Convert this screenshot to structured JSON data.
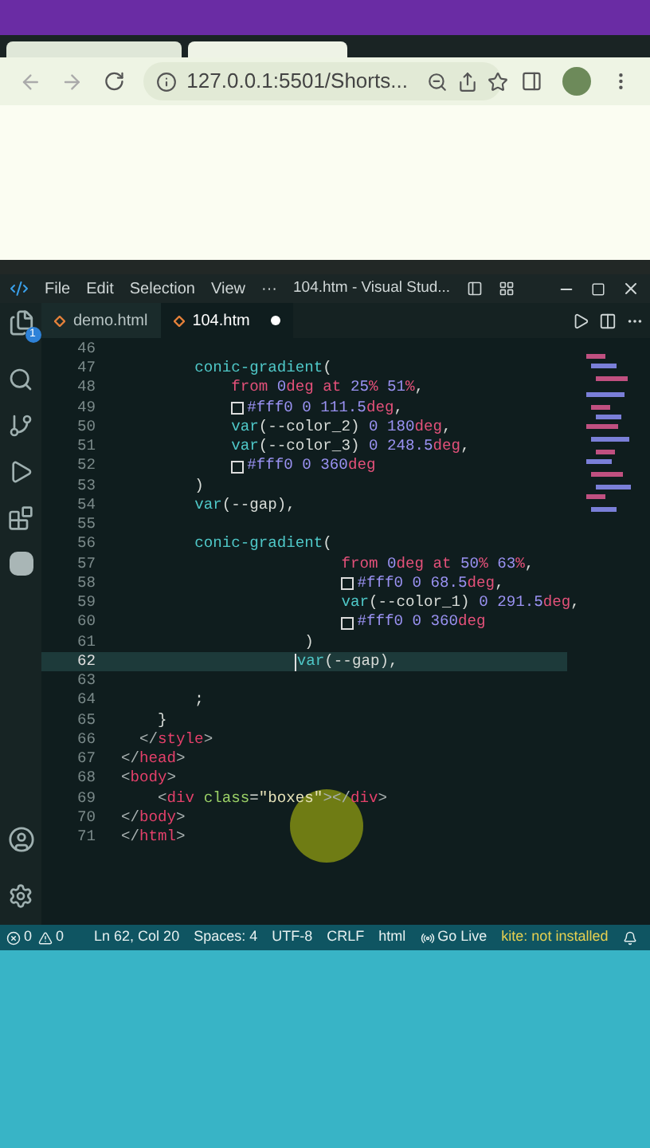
{
  "browser": {
    "address": "127.0.0.1:5501/Shorts..."
  },
  "editor": {
    "title": "104.htm - Visual Stud...",
    "menu": [
      "File",
      "Edit",
      "Selection",
      "View",
      "···"
    ],
    "explorer_badge": "1",
    "tabs": [
      {
        "label": "demo.html",
        "selected": false,
        "modified": false
      },
      {
        "label": "104.htm",
        "selected": true,
        "modified": true
      }
    ],
    "lines": [
      {
        "number": "46",
        "current": false
      },
      {
        "number": "47",
        "current": false,
        "kind": "value",
        "tokens": [
          {
            "kind": "fn",
            "text": "conic-gradient"
          },
          {
            "kind": "plain",
            "text": "("
          }
        ]
      },
      {
        "number": "48",
        "current": false,
        "kind": "argument",
        "tokens": [
          {
            "kind": "kw",
            "text": "from"
          },
          {
            "kind": "num",
            "text": " 0"
          },
          {
            "kind": "unit",
            "text": "deg"
          },
          {
            "kind": "kw",
            "text": " at"
          },
          {
            "kind": "num",
            "text": " 25"
          },
          {
            "kind": "unit",
            "text": "%"
          },
          {
            "kind": "num",
            "text": " 51"
          },
          {
            "kind": "unit",
            "text": "%"
          },
          {
            "kind": "plain",
            "text": ","
          }
        ]
      },
      {
        "number": "49",
        "current": false,
        "kind": "argument",
        "tokens": [
          {
            "kind": "swatch"
          },
          {
            "kind": "num",
            "text": "#fff0 0 111.5"
          },
          {
            "kind": "unit",
            "text": "deg"
          },
          {
            "kind": "plain",
            "text": ","
          }
        ]
      },
      {
        "number": "50",
        "current": false,
        "kind": "argument",
        "tokens": [
          {
            "kind": "fn",
            "text": "var"
          },
          {
            "kind": "plain",
            "text": "(--color_2) "
          },
          {
            "kind": "num",
            "text": "0 180"
          },
          {
            "kind": "unit",
            "text": "deg"
          },
          {
            "kind": "plain",
            "text": ","
          }
        ]
      },
      {
        "number": "51",
        "current": false,
        "kind": "argument",
        "tokens": [
          {
            "kind": "fn",
            "text": "var"
          },
          {
            "kind": "plain",
            "text": "(--color_3) "
          },
          {
            "kind": "num",
            "text": "0 248.5"
          },
          {
            "kind": "unit",
            "text": "deg"
          },
          {
            "kind": "plain",
            "text": ","
          }
        ]
      },
      {
        "number": "52",
        "current": false,
        "kind": "argument",
        "tokens": [
          {
            "kind": "swatch"
          },
          {
            "kind": "num",
            "text": "#fff0 0 360"
          },
          {
            "kind": "unit",
            "text": "deg"
          }
        ]
      },
      {
        "number": "53",
        "current": false,
        "kind": "value",
        "tokens": [
          {
            "kind": "plain",
            "text": ")"
          }
        ]
      },
      {
        "number": "54",
        "current": false,
        "kind": "value",
        "tokens": [
          {
            "kind": "fn",
            "text": "var"
          },
          {
            "kind": "plain",
            "text": "(--gap),"
          }
        ]
      },
      {
        "number": "55",
        "current": false
      },
      {
        "number": "56",
        "current": false,
        "kind": "value",
        "tokens": [
          {
            "kind": "fn",
            "text": "conic-gradient"
          },
          {
            "kind": "plain",
            "text": "("
          }
        ]
      },
      {
        "number": "57",
        "current": false,
        "kind": "nested_argument",
        "tokens": [
          {
            "kind": "kw",
            "text": "from"
          },
          {
            "kind": "num",
            "text": " 0"
          },
          {
            "kind": "unit",
            "text": "deg"
          },
          {
            "kind": "kw",
            "text": " at"
          },
          {
            "kind": "num",
            "text": " 50"
          },
          {
            "kind": "unit",
            "text": "%"
          },
          {
            "kind": "num",
            "text": " 63"
          },
          {
            "kind": "unit",
            "text": "%"
          },
          {
            "kind": "plain",
            "text": ","
          }
        ]
      },
      {
        "number": "58",
        "current": false,
        "kind": "nested_argument",
        "tokens": [
          {
            "kind": "swatch"
          },
          {
            "kind": "num",
            "text": "#fff0 0 68.5"
          },
          {
            "kind": "unit",
            "text": "deg"
          },
          {
            "kind": "plain",
            "text": ","
          }
        ]
      },
      {
        "number": "59",
        "current": false,
        "kind": "nested_argument",
        "tokens": [
          {
            "kind": "fn",
            "text": "var"
          },
          {
            "kind": "plain",
            "text": "(--color_1) "
          },
          {
            "kind": "num",
            "text": "0 291.5"
          },
          {
            "kind": "unit",
            "text": "deg"
          },
          {
            "kind": "plain",
            "text": ","
          }
        ]
      },
      {
        "number": "60",
        "current": false,
        "kind": "nested_argument",
        "tokens": [
          {
            "kind": "swatch"
          },
          {
            "kind": "num",
            "text": "#fff0 0 360"
          },
          {
            "kind": "unit",
            "text": "deg"
          }
        ]
      },
      {
        "number": "61",
        "current": false,
        "kind": "nested_close",
        "tokens": [
          {
            "kind": "plain",
            "text": ")"
          }
        ]
      },
      {
        "number": "62",
        "current": true,
        "kind": "nested_value",
        "tokens": [
          {
            "kind": "fn",
            "text": "var"
          },
          {
            "kind": "plain",
            "text": "(--gap),"
          }
        ]
      },
      {
        "number": "63",
        "current": false
      },
      {
        "number": "64",
        "current": false,
        "kind": "value",
        "tokens": [
          {
            "kind": "plain",
            "text": ";"
          }
        ]
      },
      {
        "number": "65",
        "current": false,
        "kind": "rule_close",
        "tokens": [
          {
            "kind": "plain",
            "text": "}"
          }
        ]
      },
      {
        "number": "66",
        "current": false,
        "kind": "style_close",
        "tokens": [
          {
            "kind": "bracket",
            "text": "</"
          },
          {
            "kind": "tag",
            "text": "style"
          },
          {
            "kind": "bracket",
            "text": ">"
          }
        ]
      },
      {
        "number": "67",
        "current": false,
        "tokens": [
          {
            "kind": "bracket",
            "text": "</"
          },
          {
            "kind": "tag",
            "text": "head"
          },
          {
            "kind": "bracket",
            "text": ">"
          }
        ]
      },
      {
        "number": "68",
        "current": false,
        "tokens": [
          {
            "kind": "bracket",
            "text": "<"
          },
          {
            "kind": "tag",
            "text": "body"
          },
          {
            "kind": "bracket",
            "text": ">"
          }
        ]
      },
      {
        "number": "69",
        "current": false,
        "kind": "rule_close",
        "tokens": [
          {
            "kind": "bracket",
            "text": "<"
          },
          {
            "kind": "tag",
            "text": "div"
          },
          {
            "kind": "attr",
            "text": " class"
          },
          {
            "kind": "plain",
            "text": "="
          },
          {
            "kind": "str",
            "text": "\"boxes\""
          },
          {
            "kind": "bracket",
            "text": "></"
          },
          {
            "kind": "tag",
            "text": "div"
          },
          {
            "kind": "bracket",
            "text": ">"
          }
        ]
      },
      {
        "number": "70",
        "current": false,
        "tokens": [
          {
            "kind": "bracket",
            "text": "</"
          },
          {
            "kind": "tag",
            "text": "body"
          },
          {
            "kind": "bracket",
            "text": ">"
          }
        ]
      },
      {
        "number": "71",
        "current": false,
        "tokens": [
          {
            "kind": "bracket",
            "text": "</"
          },
          {
            "kind": "tag",
            "text": "html"
          },
          {
            "kind": "bracket",
            "text": ">"
          }
        ]
      }
    ],
    "status_bar": {
      "errors": "0",
      "warnings": "0",
      "items": [
        "Ln 62, Col 20",
        "Spaces: 4",
        "UTF-8",
        "CRLF",
        "html"
      ],
      "go_live": "Go Live",
      "kite": "kite: not installed"
    }
  }
}
